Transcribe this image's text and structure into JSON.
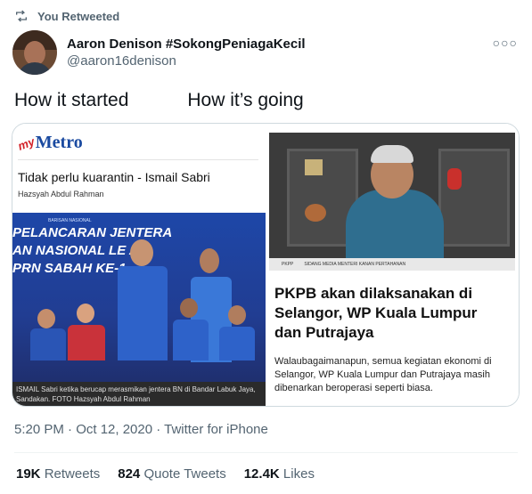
{
  "retweet": {
    "label": "You Retweeted",
    "icon": "retweet-icon"
  },
  "author": {
    "display_name": "Aaron Denison #SokongPeniagaKecil",
    "handle": "@aaron16denison"
  },
  "tweet": {
    "text_left": "How it started",
    "text_right": "How it’s going"
  },
  "left_image": {
    "logo_prefix": "my",
    "logo_name": "Metro",
    "headline": "Tidak perlu kuarantin - Ismail Sabri",
    "byline": "Hazsyah Abdul Rahman",
    "banner_small": "BARISAN NASIONAL",
    "banner_lines": [
      "PELANCARAN JENTERA",
      "AN NASIONAL LE  AN",
      "PRN SABAH KE-1"
    ],
    "caption": "ISMAIL Sabri ketika berucap merasmikan jentera BN di Bandar Labuk Jaya, Sandakan. FOTO Hazsyah Abdul Rahman"
  },
  "right_image": {
    "bar_left": "PKPP",
    "bar_right": "SIDANG MEDIA MENTERI KANAN PERTAHANAN",
    "headline": "PKPB akan dilaksanakan di Selangor, WP Kuala Lumpur dan Putrajaya",
    "body": "Walaubagaimanapun, semua kegiatan ekonomi di Selangor, WP Kuala Lumpur dan Putrajaya masih dibenarkan beroperasi seperti biasa."
  },
  "meta": {
    "timestamp": "5:20 PM · Oct 12, 2020 · Twitter for iPhone"
  },
  "stats": [
    {
      "count": "19K",
      "label": "Retweets"
    },
    {
      "count": "824",
      "label": "Quote Tweets"
    },
    {
      "count": "12.4K",
      "label": "Likes"
    }
  ],
  "colors": {
    "metro_blue": "#1a4aa0",
    "metro_red": "#d32027",
    "muted": "#536471",
    "bn_blue": "#1e47a8"
  }
}
